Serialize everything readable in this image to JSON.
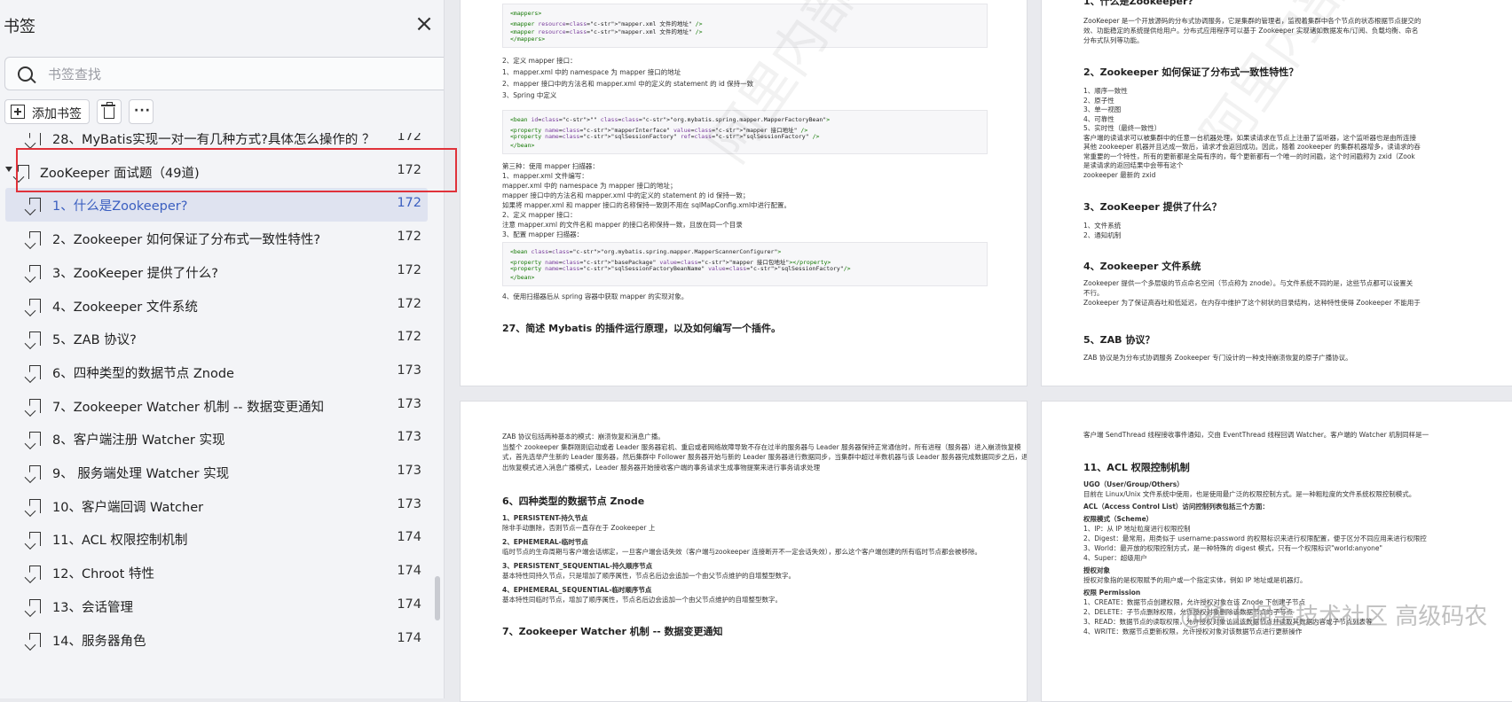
{
  "sidebar": {
    "title": "书签",
    "close_glyph": "×",
    "search_placeholder": "书签查找",
    "toolbar": {
      "add_label": "添加书签",
      "more_glyph": "···"
    },
    "items": [
      {
        "label": "28、MyBatis实现一对一有几种方式?具体怎么操作的 ？",
        "page": "172"
      },
      {
        "label": "ZooKeeper 面试题（49道)",
        "page": "172"
      },
      {
        "label": "1、什么是Zookeeper?",
        "page": "172"
      },
      {
        "label": "2、Zookeeper 如何保证了分布式一致性特性?",
        "page": "172"
      },
      {
        "label": "3、ZooKeeper 提供了什么?",
        "page": "172"
      },
      {
        "label": "4、Zookeeper 文件系统",
        "page": "172"
      },
      {
        "label": "5、ZAB 协议?",
        "page": "172"
      },
      {
        "label": "6、四种类型的数据节点 Znode",
        "page": "173"
      },
      {
        "label": "7、Zookeeper Watcher 机制 -- 数据变更通知",
        "page": "173"
      },
      {
        "label": "8、客户端注册 Watcher 实现",
        "page": "173"
      },
      {
        "label": "9、 服务端处理 Watcher 实现",
        "page": "173"
      },
      {
        "label": "10、客户端回调 Watcher",
        "page": "173"
      },
      {
        "label": "11、ACL 权限控制机制",
        "page": "174"
      },
      {
        "label": "12、Chroot 特性",
        "page": "174"
      },
      {
        "label": "13、会话管理",
        "page": "174"
      },
      {
        "label": "14、服务器角色",
        "page": "174"
      }
    ]
  },
  "page_a": {
    "code1": [
      "<mappers>",
      "<mapper resource=\"mapper.xml 文件的地址\" />",
      "<mapper resource=\"mapper.xml 文件的地址\" />",
      "</mappers>"
    ],
    "lines1": [
      "2、定义 mapper 接口：",
      "1、mapper.xml 中的 namespace 为 mapper 接口的地址",
      "2、mapper 接口中的方法名和 mapper.xml 中的定义的 statement 的 id 保持一致",
      "3、Spring 中定义"
    ],
    "code2": [
      "<bean id=\"\" class=\"org.mybatis.spring.mapper.MapperFactoryBean\">",
      "<property name=\"mapperInterface\" value=\"mapper 接口地址\" />",
      "<property name=\"sqlSessionFactory\" ref=\"sqlSessionFactory\" />",
      "</bean>"
    ],
    "lines2": [
      "第三种：使用 mapper 扫描器：",
      "1、mapper.xml 文件编写：",
      "mapper.xml 中的 namespace 为 mapper 接口的地址；",
      "mapper 接口中的方法名和 mapper.xml 中的定义的 statement 的 id 保持一致；",
      "如果将 mapper.xml 和 mapper 接口的名称保持一致则不用在 sqlMapConfig.xml中进行配置。",
      "2、定义 mapper 接口：",
      "注意 mapper.xml 的文件名和 mapper 的接口名称保持一致，且放在同一个目录",
      "3、配置 mapper 扫描器："
    ],
    "code3": [
      "<bean class=\"org.mybatis.spring.mapper.MapperScannerConfigurer\">",
      "<property name=\"basePackage\" value=\"mapper 接口包地址\"></property>",
      "<property name=\"sqlSessionFactoryBeanName\" value=\"sqlSessionFactory\"/>",
      "</bean>"
    ],
    "line3": "4、使用扫描器后从 spring 容器中获取 mapper 的实现对象。",
    "heading": "27、简述 Mybatis 的插件运行原理，以及如何编写一个插件。"
  },
  "page_b": {
    "h1": "1、什么是Zookeeper?",
    "p1": [
      "ZooKeeper 是一个开放源码的分布式协调服务，它是集群的管理者，监视着集群中各个节点的状态根据节点提交的",
      "效、功能稳定的系统提供给用户。分布式应用程序可以基于 Zookeeper 实现诸如数据发布/订阅、负载均衡、命名",
      "分布式队列等功能。"
    ],
    "h2": "2、Zookeeper 如何保证了分布式一致性特性？",
    "p2": [
      "1、顺序一致性",
      "2、原子性",
      "3、单一视图",
      "4、可靠性",
      "5、实时性（最终一致性）",
      "客户端的读请求可以被集群中的任意一台机器处理，如果读请求在节点上注册了监听器，这个监听器也是由所连接",
      "其他 zookeeper 机器并且达成一致后，请求才会返回成功。因此，随着 zookeeper 的集群机器增多，读请求的吞",
      "常重要的一个特性，所有的更新都是全局有序的，每个更新都有一个唯一的时间戳，这个时间戳称为 zxid（Zook",
      "是读请求的返回结果中会带有这个",
      "zookeeper 最新的 zxid"
    ],
    "h3": "3、ZooKeeper 提供了什么？",
    "p3": [
      "1、文件系统",
      "2、通知机制"
    ],
    "h4": "4、Zookeeper 文件系统",
    "p4": [
      "Zookeeper 提供一个多层级的节点命名空间（节点称为 znode）。与文件系统不同的是，这些节点都可以设置关",
      "不行。",
      "Zookeeper 为了保证高吞吐和低延迟，在内存中维护了这个树状的目录结构，这种特性使得 Zookeeper 不能用于"
    ],
    "h5": "5、ZAB 协议？",
    "p5": [
      "ZAB 协议是为分布式协调服务 Zookeeper 专门设计的一种支持崩溃恢复的原子广播协议。"
    ]
  },
  "page_c": {
    "p1": [
      "ZAB 协议包括两种基本的模式：崩溃恢复和消息广播。",
      "当整个 zookeeper 集群刚刚启动或者 Leader 服务器宕机、重启或者网络故障导致不存在过半的服务器与 Leader 服务器保持正常通信时，所有进程（服务器）进入崩溃恢复模",
      "式，首先选举产生新的 Leader 服务器，然后集群中 Follower 服务器开始与新的 Leader 服务器进行数据同步，当集群中超过半数机器与该 Leader 服务器完成数据同步之后，退",
      "出恢复模式进入消息广播模式，Leader 服务器开始接收客户端的事务请求生成事物提案来进行事务请求处理"
    ],
    "h1": "6、四种类型的数据节点 Znode",
    "items": [
      {
        "t": "1、PERSISTENT-持久节点",
        "d": "除非手动删除，否则节点一直存在于 Zookeeper 上"
      },
      {
        "t": "2、EPHEMERAL-临时节点",
        "d": "临时节点的生命周期与客户端会话绑定，一旦客户端会话失效（客户端与zookeeper 连接断开不一定会话失效），那么这个客户端创建的所有临时节点都会被移除。"
      },
      {
        "t": "3、PERSISTENT_SEQUENTIAL-持久顺序节点",
        "d": "基本特性同持久节点，只是增加了顺序属性，节点名后边会追加一个由父节点维护的自增整型数字。"
      },
      {
        "t": "4、EPHEMERAL_SEQUENTIAL-临时顺序节点",
        "d": "基本特性同临时节点，增加了顺序属性，节点名后边会追加一个由父节点维护的自增整型数字。"
      }
    ],
    "h2": "7、Zookeeper Watcher 机制 -- 数据变更通知"
  },
  "page_d": {
    "p0": "客户端 SendThread 线程接收事件通知，交由 EventThread 线程回调 Watcher。客户端的 Watcher 机制同样是一",
    "h1": "11、ACL 权限控制机制",
    "lines": [
      {
        "b": true,
        "t": "UGO（User/Group/Others）"
      },
      {
        "b": false,
        "t": "目前在 Linux/Unix 文件系统中使用，也是使用最广泛的权限控制方式。是一种粗粒度的文件系统权限控制模式。"
      },
      {
        "b": true,
        "t": "ACL（Access Control List）访问控制列表包括三个方面："
      },
      {
        "b": true,
        "t": "权限模式（Scheme）"
      },
      {
        "b": false,
        "t": "1、IP：从 IP 地址粒度进行权限控制"
      },
      {
        "b": false,
        "t": "2、Digest：最常用，用类似于 username:password 的权限标识来进行权限配置，便于区分不同应用来进行权限控"
      },
      {
        "b": false,
        "t": "3、World：最开放的权限控制方式，是一种特殊的 digest 模式，只有一个权限标识\"world:anyone\""
      },
      {
        "b": false,
        "t": "4、Super：超级用户"
      },
      {
        "b": true,
        "t": "授权对象"
      },
      {
        "b": false,
        "t": "授权对象指的是权限赋予的用户或一个指定实体，例如 IP 地址或是机器灯。"
      },
      {
        "b": true,
        "t": "权限 Permission"
      },
      {
        "b": false,
        "t": "1、CREATE：数据节点创建权限，允许授权对象在该 Znode 下创建子节点"
      },
      {
        "b": false,
        "t": "2、DELETE：子节点删除权限，允许授权对象删除该数据节点的子节点"
      },
      {
        "b": false,
        "t": "3、READ：数据节点的读取权限，允许授权对象访问该数据节点并读取其数据内容或子节点列表等"
      },
      {
        "b": false,
        "t": "4、WRITE：数据节点更新权限，允许授权对象对该数据节点进行更新操作"
      }
    ],
    "watermark": "@稀土掘金技术社区 高级码农"
  }
}
